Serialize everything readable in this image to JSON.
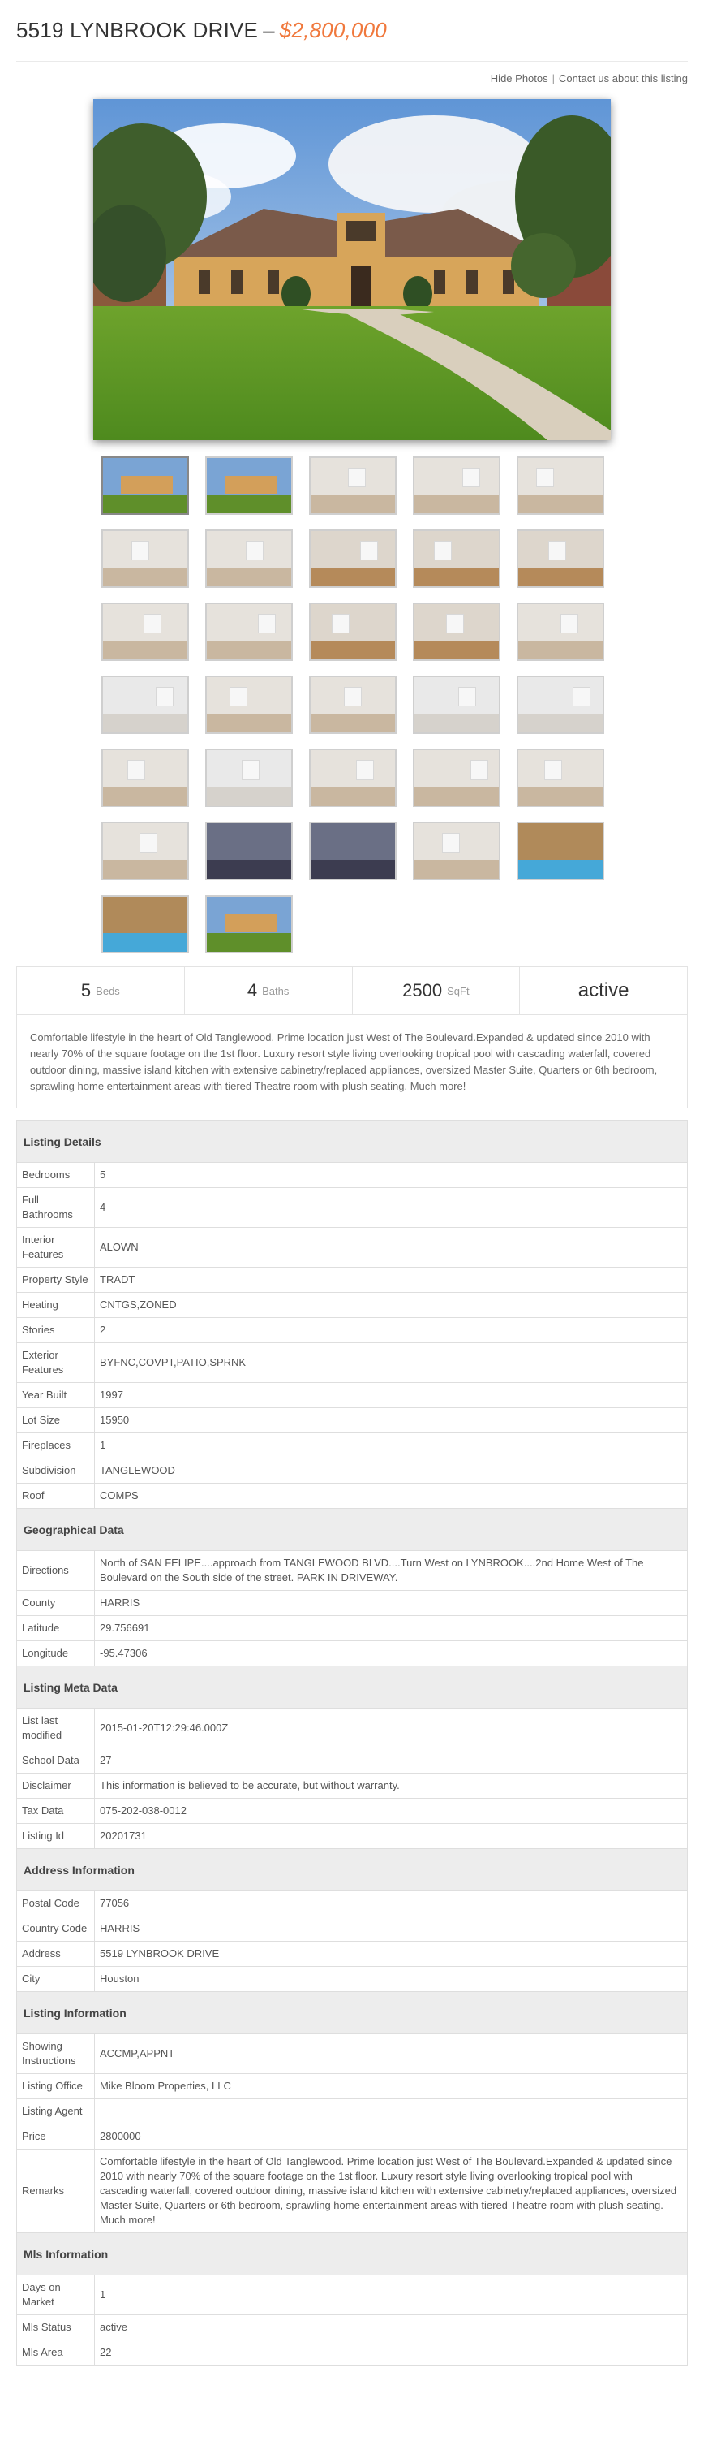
{
  "header": {
    "address": "5519 LYNBROOK DRIVE",
    "dash": "–",
    "price": "$2,800,000"
  },
  "links": {
    "hide_photos": "Hide Photos",
    "separator": "|",
    "contact": "Contact us about this listing"
  },
  "stats": [
    {
      "num": "5",
      "label": "Beds"
    },
    {
      "num": "4",
      "label": "Baths"
    },
    {
      "num": "2500",
      "label": "SqFt"
    }
  ],
  "status": "active",
  "description": "Comfortable lifestyle in the heart of Old Tanglewood. Prime location just West of The Boulevard.Expanded & updated since 2010 with nearly 70% of the square footage on the 1st floor. Luxury resort style living overlooking tropical pool with cascading waterfall, covered outdoor dining, massive island kitchen with extensive cabinetry/replaced appliances, oversized Master Suite, Quarters or 6th bedroom, sprawling home entertainment areas with tiered Theatre room with plush seating. Much more!",
  "sections": [
    {
      "title": "Listing Details",
      "rows": [
        {
          "k": "Bedrooms",
          "v": "5"
        },
        {
          "k": "Full Bathrooms",
          "v": "4"
        },
        {
          "k": "Interior Features",
          "v": "ALOWN"
        },
        {
          "k": "Property Style",
          "v": "TRADT"
        },
        {
          "k": "Heating",
          "v": "CNTGS,ZONED"
        },
        {
          "k": "Stories",
          "v": "2"
        },
        {
          "k": "Exterior Features",
          "v": "BYFNC,COVPT,PATIO,SPRNK"
        },
        {
          "k": "Year Built",
          "v": "1997"
        },
        {
          "k": "Lot Size",
          "v": "15950"
        },
        {
          "k": "Fireplaces",
          "v": "1"
        },
        {
          "k": "Subdivision",
          "v": "TANGLEWOOD"
        },
        {
          "k": "Roof",
          "v": "COMPS"
        }
      ]
    },
    {
      "title": "Geographical Data",
      "rows": [
        {
          "k": "Directions",
          "v": "North of SAN FELIPE....approach from TANGLEWOOD BLVD....Turn West on LYNBROOK....2nd Home West of The Boulevard on the South side of the street. PARK IN DRIVEWAY."
        },
        {
          "k": "County",
          "v": "HARRIS"
        },
        {
          "k": "Latitude",
          "v": "29.756691"
        },
        {
          "k": "Longitude",
          "v": "-95.47306"
        }
      ]
    },
    {
      "title": "Listing Meta Data",
      "rows": [
        {
          "k": "List last modified",
          "v": "2015-01-20T12:29:46.000Z"
        },
        {
          "k": "School Data",
          "v": "27"
        },
        {
          "k": "Disclaimer",
          "v": "This information is believed to be accurate, but without warranty."
        },
        {
          "k": "Tax Data",
          "v": "075-202-038-0012"
        },
        {
          "k": "Listing Id",
          "v": "20201731"
        }
      ]
    },
    {
      "title": "Address Information",
      "rows": [
        {
          "k": "Postal Code",
          "v": "77056"
        },
        {
          "k": "Country Code",
          "v": "HARRIS"
        },
        {
          "k": "Address",
          "v": "5519 LYNBROOK DRIVE"
        },
        {
          "k": "City",
          "v": "Houston"
        }
      ]
    },
    {
      "title": "Listing Information",
      "rows": [
        {
          "k": "Showing Instructions",
          "v": "ACCMP,APPNT"
        },
        {
          "k": "Listing Office",
          "v": "Mike Bloom Properties, LLC"
        },
        {
          "k": "Listing Agent",
          "v": ""
        },
        {
          "k": "Price",
          "v": "2800000"
        },
        {
          "k": "Remarks",
          "v": "Comfortable lifestyle in the heart of Old Tanglewood. Prime location just West of The Boulevard.Expanded & updated since 2010 with nearly 70% of the square footage on the 1st floor. Luxury resort style living overlooking tropical pool with cascading waterfall, covered outdoor dining, massive island kitchen with extensive cabinetry/replaced appliances, oversized Master Suite, Quarters or 6th bedroom, sprawling home entertainment areas with tiered Theatre room with plush seating. Much more!"
        }
      ]
    },
    {
      "title": "Mls Information",
      "rows": [
        {
          "k": "Days on Market",
          "v": "1"
        },
        {
          "k": "Mls Status",
          "v": "active"
        },
        {
          "k": "Mls Area",
          "v": "22"
        }
      ]
    }
  ],
  "thumbnails": [
    "exterior",
    "exterior",
    "interior",
    "interior",
    "interior",
    "interior",
    "interior",
    "kitchen",
    "kitchen",
    "kitchen",
    "interior",
    "interior",
    "kitchen",
    "kitchen",
    "interior",
    "bath",
    "interior",
    "interior",
    "bath",
    "bath",
    "interior",
    "bath",
    "interior",
    "interior",
    "interior",
    "interior",
    "theater",
    "theater",
    "interior",
    "pool",
    "pool",
    "exterior"
  ],
  "colors": {
    "accent_price": "#f0783c",
    "section_header_bg": "#ededed"
  }
}
